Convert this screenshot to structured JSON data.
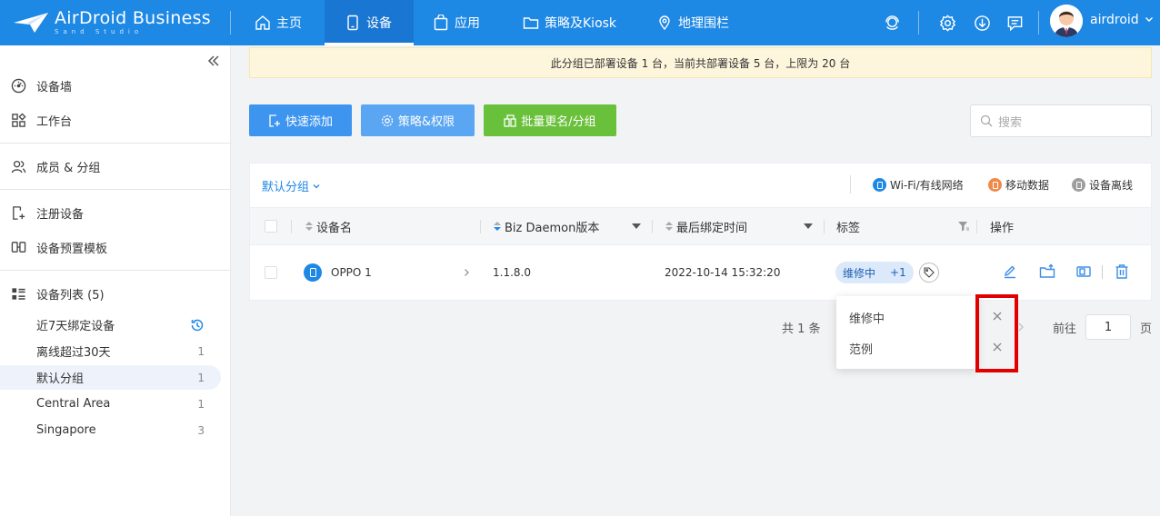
{
  "brand": {
    "name": "AirDroid Business",
    "sub": "Sand Studio"
  },
  "nav": [
    {
      "label": "主页",
      "icon": "home-icon"
    },
    {
      "label": "设备",
      "icon": "device-icon"
    },
    {
      "label": "应用",
      "icon": "app-bag-icon"
    },
    {
      "label": "策略及Kiosk",
      "icon": "folder-icon"
    },
    {
      "label": "地理围栏",
      "icon": "geofence-icon"
    }
  ],
  "user": {
    "name": "airdroid"
  },
  "sidebar": {
    "items": [
      {
        "label": "设备墙",
        "icon": "dashboard-icon"
      },
      {
        "label": "工作台",
        "icon": "workbench-icon"
      },
      {
        "label": "成员 & 分组",
        "icon": "members-icon"
      },
      {
        "label": "注册设备",
        "icon": "register-device-icon"
      },
      {
        "label": "设备预置模板",
        "icon": "template-icon"
      },
      {
        "label": "设备列表 (5)",
        "icon": "list-icon"
      }
    ],
    "groups": [
      {
        "label": "近7天绑定设备",
        "count": ""
      },
      {
        "label": "离线超过30天",
        "count": "1"
      },
      {
        "label": "默认分组",
        "count": "1"
      },
      {
        "label": "Central Area",
        "count": "1"
      },
      {
        "label": "Singapore",
        "count": "3"
      }
    ]
  },
  "notice": "此分组已部署设备 1 台，当前共部署设备 5 台，上限为 20 台",
  "toolbar": {
    "quick_add": "快速添加",
    "policy": "策略&权限",
    "rename": "批量更名/分组"
  },
  "search": {
    "placeholder": "搜索"
  },
  "table": {
    "group": "默认分组",
    "legend": {
      "wifi": "Wi-Fi/有线网络",
      "mobile": "移动数据",
      "offline": "设备离线"
    },
    "headers": {
      "name": "设备名",
      "daemon": "Biz Daemon版本",
      "bind_time": "最后绑定时间",
      "tags": "标签",
      "actions": "操作"
    },
    "rows": [
      {
        "name": "OPPO 1",
        "daemon": "1.1.8.0",
        "bind_time": "2022-10-14 15:32:20",
        "tag": "维修中",
        "more": "+1"
      }
    ]
  },
  "pager": {
    "total": "共 1 条",
    "goto": "前往",
    "page": "1",
    "unit": "页"
  },
  "popover": {
    "tags": [
      "维修中",
      "范例"
    ]
  },
  "colors": {
    "primary": "#1e88e5",
    "green": "#69c03a",
    "mobile": "#f08a4b",
    "offline": "#9e9e9e",
    "highlight": "#e00000"
  }
}
